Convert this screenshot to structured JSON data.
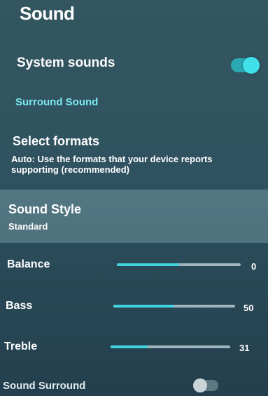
{
  "title": "Sound",
  "system_sounds": {
    "label": "System sounds",
    "enabled": true
  },
  "surround_sound_link": "Surround Sound",
  "select_formats": {
    "title": "Select formats",
    "description": "Auto: Use the formats that your device reports supporting (recommended)"
  },
  "sound_style": {
    "title": "Sound Style",
    "value": "Standard"
  },
  "sliders": [
    {
      "label": "Balance",
      "value": "0",
      "level": 0.5
    },
    {
      "label": "Bass",
      "value": "50",
      "level": 0.5
    },
    {
      "label": "Treble",
      "value": "31",
      "level": 0.31
    }
  ],
  "sound_surround": {
    "label": "Sound Surround",
    "enabled": false
  },
  "colors": {
    "accent": "#3fd5df",
    "track": "#9fb4bb",
    "link": "#7be8f0"
  }
}
